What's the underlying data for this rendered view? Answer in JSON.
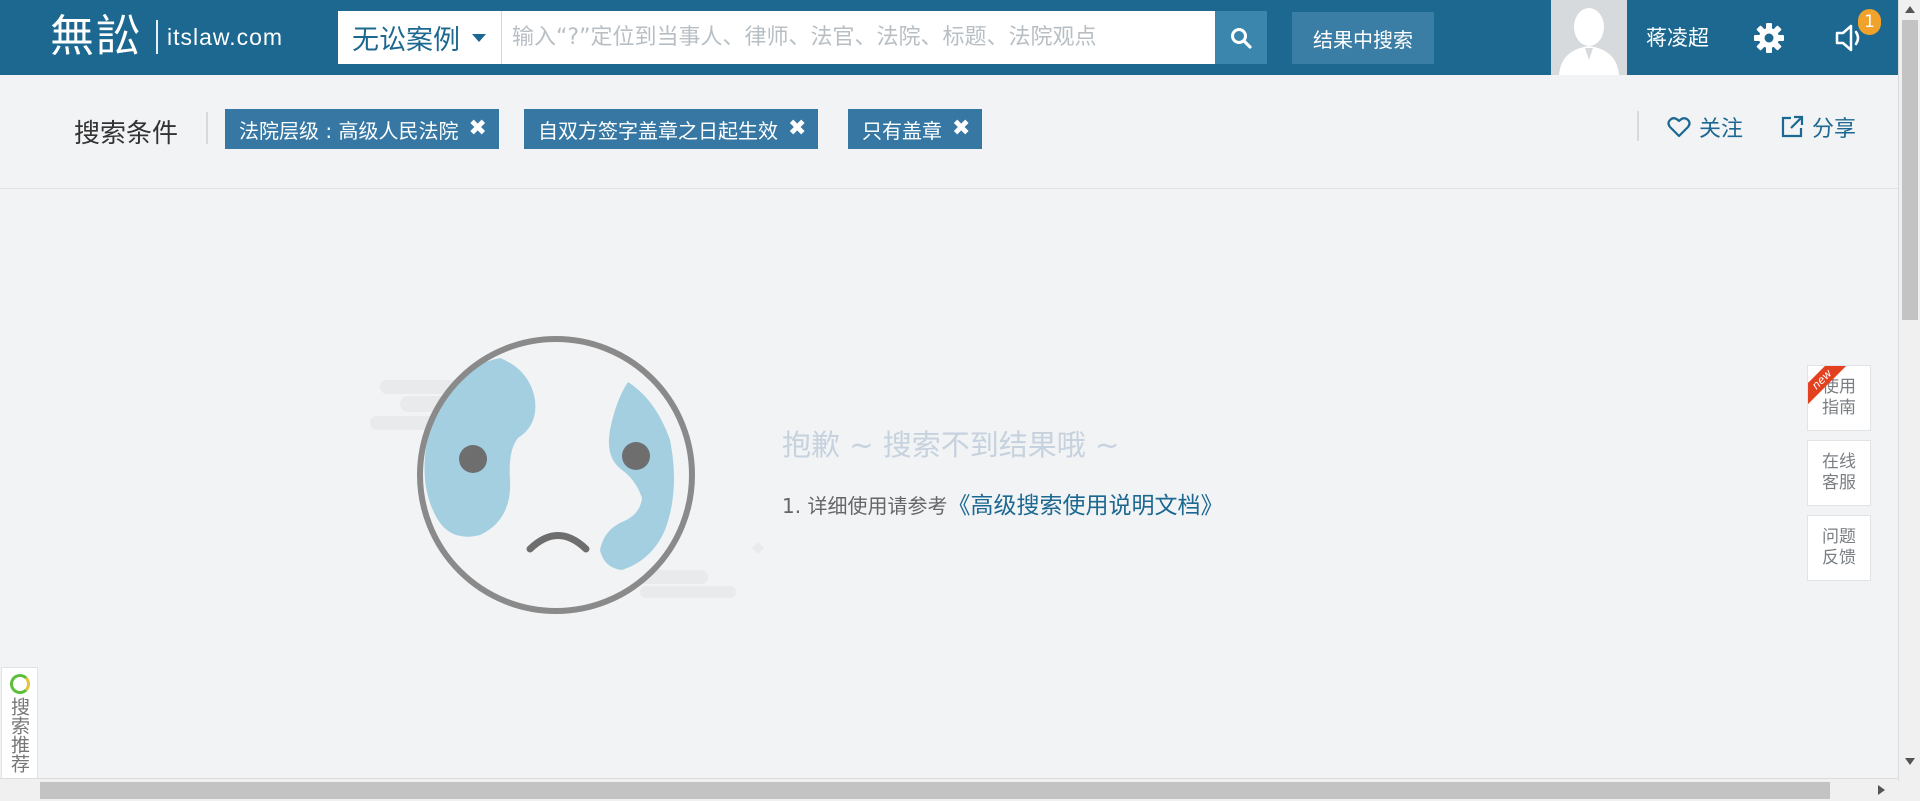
{
  "header": {
    "logo_mark": "無訟",
    "logo_domain": "itslaw.com",
    "search_type": "无讼案例",
    "search_placeholder": "输入“?”定位到当事人、律师、法官、法院、标题、法院观点",
    "search_within_label": "结果中搜索",
    "username": "蒋凌超",
    "notification_count": "1"
  },
  "filters": {
    "title": "搜索条件",
    "chips": [
      {
        "label": "法院层级 : 高级人民法院"
      },
      {
        "label": "自双方签字盖章之日起生效"
      },
      {
        "label": "只有盖章"
      }
    ],
    "remove_glyph": "✖",
    "follow_label": "关注",
    "share_label": "分享"
  },
  "empty_state": {
    "message": "抱歉 ~ 搜索不到结果哦 ~",
    "tip_prefix": "1.  详细使用请参考",
    "tip_link": "《高级搜索使用说明文档》"
  },
  "side_tools": {
    "guide": {
      "line1": "使用",
      "line2": "指南",
      "badge": "new"
    },
    "service": {
      "line1": "在线",
      "line2": "客服"
    },
    "feedback": {
      "line1": "问题",
      "line2": "反馈"
    }
  },
  "left_tab": {
    "label": "搜索推荐"
  },
  "icons": {
    "search": "search-icon",
    "gear": "gear-icon",
    "speaker": "speaker-icon",
    "heart": "heart-icon",
    "share": "share-icon"
  },
  "colors": {
    "header_bg": "#1c6891",
    "chip_bg": "#3678a3",
    "link": "#1c6891",
    "badge": "#f0a22a",
    "new_ribbon": "#e3401f",
    "page_bg": "#f2f3f5"
  }
}
